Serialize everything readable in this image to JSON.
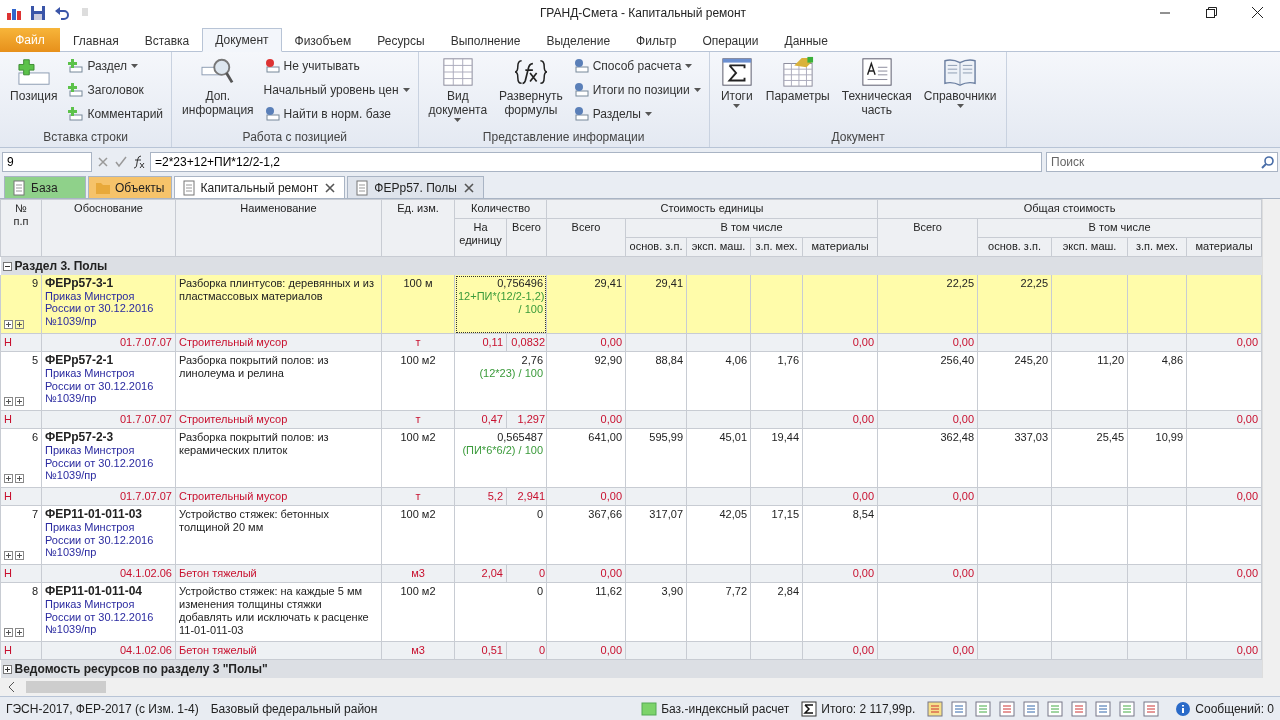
{
  "window": {
    "title": "ГРАНД-Смета - Капитальный ремонт"
  },
  "ribbon": {
    "file_tab": "Файл",
    "tabs": [
      {
        "label": "Главная",
        "selected": false
      },
      {
        "label": "Вставка",
        "selected": false
      },
      {
        "label": "Документ",
        "selected": true
      },
      {
        "label": "Физобъем",
        "selected": false
      },
      {
        "label": "Ресурсы",
        "selected": false
      },
      {
        "label": "Выполнение",
        "selected": false
      },
      {
        "label": "Выделение",
        "selected": false
      },
      {
        "label": "Фильтр",
        "selected": false
      },
      {
        "label": "Операции",
        "selected": false
      },
      {
        "label": "Данные",
        "selected": false
      }
    ],
    "groups": [
      {
        "label": "Вставка строки",
        "large": [
          {
            "label": "Позиция",
            "dropdown": false
          }
        ],
        "small": [
          {
            "label": "Раздел",
            "dropdown": true
          },
          {
            "label": "Заголовок",
            "dropdown": false
          },
          {
            "label": "Комментарий",
            "dropdown": false
          }
        ]
      },
      {
        "label": "Работа с позицией",
        "large": [
          {
            "label": "Доп.\nинформация",
            "dropdown": false
          }
        ],
        "small": [
          {
            "label": "Не учитывать",
            "dropdown": false
          },
          {
            "label": "Начальный уровень цен",
            "dropdown": true
          },
          {
            "label": "Найти в норм. базе",
            "dropdown": false
          }
        ]
      },
      {
        "label": "Представление информации",
        "large": [
          {
            "label": "Вид\nдокумента",
            "dropdown": true
          },
          {
            "label": "Развернуть\nформулы",
            "dropdown": false
          }
        ],
        "small": [
          {
            "label": "Способ расчета",
            "dropdown": true
          },
          {
            "label": "Итоги по позиции",
            "dropdown": true
          },
          {
            "label": "Разделы",
            "dropdown": true
          }
        ]
      },
      {
        "label": "Документ",
        "large": [
          {
            "label": "Итоги",
            "dropdown": true
          },
          {
            "label": "Параметры",
            "dropdown": false
          },
          {
            "label": "Техническая\nчасть",
            "dropdown": false
          },
          {
            "label": "Справочники",
            "dropdown": true
          }
        ]
      }
    ]
  },
  "formula_bar": {
    "cell": "9",
    "formula": "=2*23+12+ПИ*12/2-1,2",
    "search_placeholder": "Поиск"
  },
  "doc_tabs": [
    {
      "label": "База",
      "kind": "base"
    },
    {
      "label": "Объекты",
      "kind": "objects"
    },
    {
      "label": "Капитальный ремонт",
      "kind": "doc",
      "selected": true
    },
    {
      "label": "ФЕРр57. Полы",
      "kind": "doc",
      "selected": false
    }
  ],
  "table": {
    "headers": {
      "num": "№\nп.п",
      "justification": "Обоснование",
      "name": "Наименование",
      "unit": "Ед. изм.",
      "quantity": "Количество",
      "qty_per_unit": "На\nединицу",
      "qty_total": "Всего",
      "unit_cost": "Стоимость единицы",
      "unit_cost_total": "Всего",
      "unit_cost_including": "В том числе",
      "unit_cost_parts": [
        "основ. з.п.",
        "эксп. маш.",
        "з.п. мех.",
        "материалы"
      ],
      "total_cost": "Общая стоимость",
      "total_cost_total": "Всего",
      "total_cost_including": "В том числе",
      "total_cost_parts": [
        "основ. з.п.",
        "эксп. маш.",
        "з.п. мех.",
        "материалы"
      ]
    },
    "section": {
      "title": "Раздел 3. Полы",
      "expanded": true
    },
    "rows": [
      {
        "kind": "position",
        "selected": true,
        "num": "9",
        "code": "ФЕРр57-3-1",
        "justification": "Приказ Минстроя\nРоссии от 30.12.2016\n№1039/пр",
        "name": "Разборка плинтусов: деревянных и из пластмассовых материалов",
        "unit": "100 м",
        "qty": "0,756496",
        "formula": "12+ПИ*(12/2-1,2)\n/ 100",
        "unit_cost": {
          "total": "29,41",
          "base_wage": "29,41"
        },
        "total_cost": {
          "total": "22,25",
          "base_wage": "22,25"
        }
      },
      {
        "kind": "resource",
        "selected": false,
        "type": "Н",
        "code": "01.7.07.07",
        "name": "Строительный мусор",
        "unit": "т",
        "qty": "0,11",
        "qty_total": "0,0832",
        "unit_cost": {
          "total": "0,00",
          "materials": "0,00"
        },
        "total_cost": {
          "total": "0,00",
          "materials": "0,00"
        }
      },
      {
        "kind": "position",
        "selected": false,
        "num": "5",
        "code": "ФЕРр57-2-1",
        "justification": "Приказ Минстроя\nРоссии от 30.12.2016\n№1039/пр",
        "name": "Разборка покрытий полов: из линолеума и релина",
        "unit": "100 м2",
        "qty": "2,76",
        "formula": "(12*23) / 100",
        "unit_cost": {
          "total": "92,90",
          "base_wage": "88,84",
          "machines": "4,06",
          "machine_wage": "1,76"
        },
        "total_cost": {
          "total": "256,40",
          "base_wage": "245,20",
          "machines": "11,20",
          "machine_wage": "4,86"
        }
      },
      {
        "kind": "resource",
        "selected": false,
        "type": "Н",
        "code": "01.7.07.07",
        "name": "Строительный мусор",
        "unit": "т",
        "qty": "0,47",
        "qty_total": "1,297",
        "unit_cost": {
          "total": "0,00",
          "materials": "0,00"
        },
        "total_cost": {
          "total": "0,00",
          "materials": "0,00"
        }
      },
      {
        "kind": "position",
        "selected": false,
        "num": "6",
        "code": "ФЕРр57-2-3",
        "justification": "Приказ Минстроя\nРоссии от 30.12.2016\n№1039/пр",
        "name": "Разборка покрытий полов: из керамических плиток",
        "unit": "100 м2",
        "qty": "0,565487",
        "formula": "(ПИ*6*6/2) / 100",
        "unit_cost": {
          "total": "641,00",
          "base_wage": "595,99",
          "machines": "45,01",
          "machine_wage": "19,44"
        },
        "total_cost": {
          "total": "362,48",
          "base_wage": "337,03",
          "machines": "25,45",
          "machine_wage": "10,99"
        }
      },
      {
        "kind": "resource",
        "selected": false,
        "type": "Н",
        "code": "01.7.07.07",
        "name": "Строительный мусор",
        "unit": "т",
        "qty": "5,2",
        "qty_total": "2,941",
        "unit_cost": {
          "total": "0,00",
          "materials": "0,00"
        },
        "total_cost": {
          "total": "0,00",
          "materials": "0,00"
        }
      },
      {
        "kind": "position",
        "selected": false,
        "num": "7",
        "code": "ФЕР11-01-011-03",
        "justification": "Приказ Минстроя\nРоссии от 30.12.2016\n№1039/пр",
        "name": "Устройство стяжек: бетонных толщиной 20 мм",
        "unit": "100 м2",
        "qty": "0",
        "unit_cost": {
          "total": "367,66",
          "base_wage": "317,07",
          "machines": "42,05",
          "machine_wage": "17,15",
          "materials": "8,54"
        },
        "total_cost": {}
      },
      {
        "kind": "resource",
        "selected": false,
        "type": "Н",
        "code": "04.1.02.06",
        "name": "Бетон тяжелый",
        "unit": "м3",
        "qty": "2,04",
        "qty_total": "0",
        "unit_cost": {
          "total": "0,00",
          "materials": "0,00"
        },
        "total_cost": {
          "total": "0,00",
          "materials": "0,00"
        }
      },
      {
        "kind": "position",
        "selected": false,
        "num": "8",
        "code": "ФЕР11-01-011-04",
        "justification": "Приказ Минстроя\nРоссии от 30.12.2016\n№1039/пр",
        "name": "Устройство стяжек: на каждые 5 мм изменения толщины стяжки добавлять или исключать к расценке 11-01-011-03",
        "unit": "100 м2",
        "qty": "0",
        "unit_cost": {
          "total": "11,62",
          "base_wage": "3,90",
          "machines": "7,72",
          "machine_wage": "2,84"
        },
        "total_cost": {}
      },
      {
        "kind": "resource",
        "selected": false,
        "type": "Н",
        "code": "04.1.02.06",
        "name": "Бетон тяжелый",
        "unit": "м3",
        "qty": "0,51",
        "qty_total": "0",
        "unit_cost": {
          "total": "0,00",
          "materials": "0,00"
        },
        "total_cost": {
          "total": "0,00",
          "materials": "0,00"
        }
      }
    ],
    "footer_section": {
      "title": "Ведомость ресурсов по разделу 3 \"Полы\"",
      "expanded": false
    }
  },
  "status_bar": {
    "norm_base": "ГЭСН-2017, ФЕР-2017 (с Изм. 1-4)",
    "region": "Базовый федеральный район",
    "calc_mode": "Баз.-индексный расчет",
    "total": "Итого: 2 117,99р.",
    "messages": "Сообщений: 0"
  }
}
